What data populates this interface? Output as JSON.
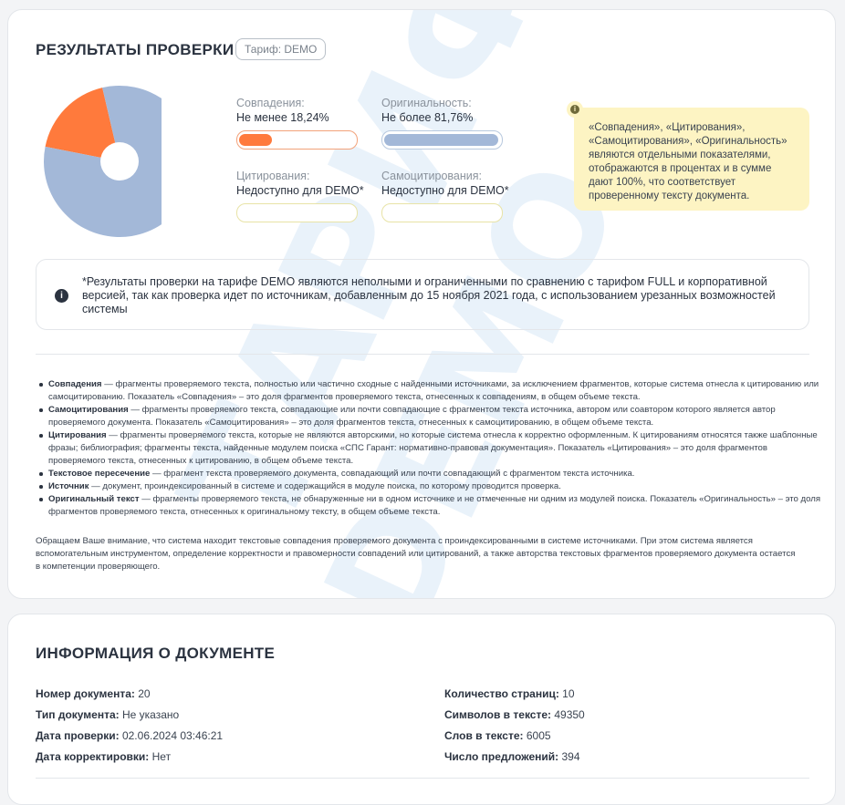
{
  "results": {
    "title": "РЕЗУЛЬТАТЫ ПРОВЕРКИ",
    "tariff": "Тариф: DEMO",
    "watermark_1": "ТАРИФ",
    "watermark_2": "DEMO",
    "chart_data": {
      "type": "pie",
      "title": "",
      "slices": [
        {
          "value": 18.24,
          "color": "#ff7a3c"
        },
        {
          "value": 81.76,
          "color": "#a3b8d8"
        }
      ]
    },
    "metrics": {
      "matches": {
        "label": "Совпадения:",
        "value": "Не менее 18,24%",
        "percent": 18.24
      },
      "originality": {
        "label": "Оригинальность:",
        "value": "Не более 81,76%",
        "percent": 81.76
      },
      "citations": {
        "label": "Цитирования:",
        "value": "Недоступно для DEMO*"
      },
      "self_citations": {
        "label": "Самоцитирования:",
        "value": "Недоступно для DEMO*"
      }
    },
    "colors": {
      "matches": "#ff7a3c",
      "originality": "#a3b8d8",
      "note_bg": "#fdf4c3"
    },
    "yellow_note": {
      "icon": "info-icon",
      "text": "«Совпадения», «Цитирования», «Самоцитирования», «Оригинальность» являются отдельными показателями, отображаются в процентах и в сумме дают 100%, что соответствует проверенному тексту документа."
    },
    "demo_note": {
      "icon": "info-icon",
      "text": "*Результаты проверки на тарифе DEMO являются неполными и ограниченными по сравнению с тарифом FULL и корпоративной версией, так как проверка идет по источникам, добавленным до 15 ноября 2021 года, с использованием урезанных возможностей системы"
    },
    "definitions": [
      {
        "term": "Совпадения",
        "text": " — фрагменты проверяемого текста, полностью или частично сходные с найденными источниками, за исключением фрагментов, которые система отнесла к цитированию или самоцитированию. Показатель «Совпадения» – это доля фрагментов проверяемого текста, отнесенных к совпадениям, в общем объеме текста."
      },
      {
        "term": "Самоцитирования",
        "text": " — фрагменты проверяемого текста, совпадающие или почти совпадающие с фрагментом текста источника, автором или соавтором которого является автор проверяемого документа. Показатель «Самоцитирования» – это доля фрагментов текста, отнесенных к самоцитированию, в общем объеме текста."
      },
      {
        "term": "Цитирования",
        "text": " — фрагменты проверяемого текста, которые не являются авторскими, но которые система отнесла к корректно оформленным. К цитированиям относятся также шаблонные фразы; библиография; фрагменты текста, найденные модулем поиска «СПС Гарант: нормативно-правовая документация». Показатель «Цитирования» – это доля фрагментов проверяемого текста, отнесенных к цитированию, в общем объеме текста."
      },
      {
        "term": "Текстовое пересечение",
        "text": " — фрагмент текста проверяемого документа, совпадающий или почти совпадающий с фрагментом текста источника."
      },
      {
        "term": "Источник",
        "text": " — документ, проиндексированный в системе и содержащийся в модуле поиска, по которому проводится проверка."
      },
      {
        "term": "Оригинальный текст",
        "text": " — фрагменты проверяемого текста, не обнаруженные ни в одном источнике и не отмеченные ни одним из модулей поиска. Показатель «Оригинальность» – это доля фрагментов проверяемого текста, отнесенных к оригинальному тексту, в общем объеме текста."
      }
    ],
    "attention": "Обращаем Ваше внимание, что система находит текстовые совпадения проверяемого документа с проиндексированными в системе источниками. При этом система является вспомогательным инструментом, определение корректности и правомерности совпадений или цитирований, а также авторства текстовых фрагментов проверяемого документа остается в компетенции проверяющего."
  },
  "document": {
    "title": "ИНФОРМАЦИЯ О ДОКУМЕНТЕ",
    "left": [
      {
        "label": "Номер документа:",
        "value": "20"
      },
      {
        "label": "Тип документа:",
        "value": "Не указано"
      },
      {
        "label": "Дата проверки:",
        "value": "02.06.2024 03:46:21"
      },
      {
        "label": "Дата корректировки:",
        "value": "Нет"
      }
    ],
    "right": [
      {
        "label": "Количество страниц:",
        "value": "10"
      },
      {
        "label": "Символов в тексте:",
        "value": "49350"
      },
      {
        "label": "Слов в тексте:",
        "value": "6005"
      },
      {
        "label": "Число предложений:",
        "value": "394"
      }
    ]
  }
}
